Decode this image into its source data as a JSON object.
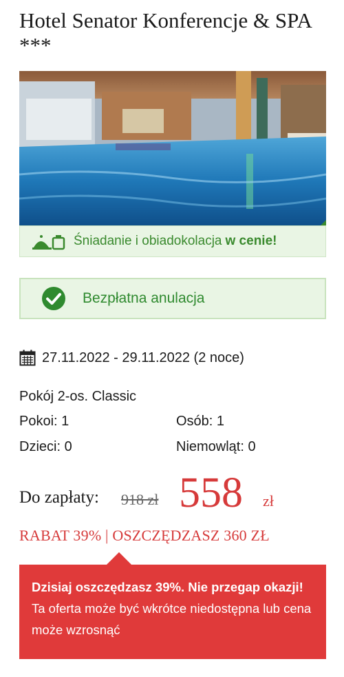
{
  "hotel": {
    "name": "Hotel Senator Konferencje & SPA ***",
    "image": "indoor-pool-photo"
  },
  "meal": {
    "icon": "meal-tray-icon",
    "text": "Śniadanie i obiadokolacja",
    "highlight": "w cenie!"
  },
  "cancellation": {
    "icon": "check-circle-icon",
    "text": "Bezpłatna anulacja"
  },
  "booking": {
    "calendar_icon": "calendar-icon",
    "dates": "27.11.2022 - 29.11.2022 (2 noce)",
    "room": "Pokój 2-os. Classic",
    "rooms": "Pokoi: 1",
    "persons": "Osób: 1",
    "children": "Dzieci: 0",
    "infants": "Niemowląt: 0"
  },
  "price": {
    "label": "Do zapłaty:",
    "old": "918 zł",
    "new": "558",
    "currency": "zł",
    "discount": "RABAT 39% | OSZCZĘDZASZ 360 ZŁ"
  },
  "promo": {
    "bold": "Dzisiaj oszczędzasz 39%. Nie przegap okazji!",
    "text": " Ta oferta może być wkrótce niedostępna lub cena może wzrosnąć"
  },
  "colors": {
    "accent_red": "#e03a3a",
    "price_red": "#d63a3a",
    "success_green": "#2f8a2f",
    "success_bg": "#e9f5e4"
  }
}
